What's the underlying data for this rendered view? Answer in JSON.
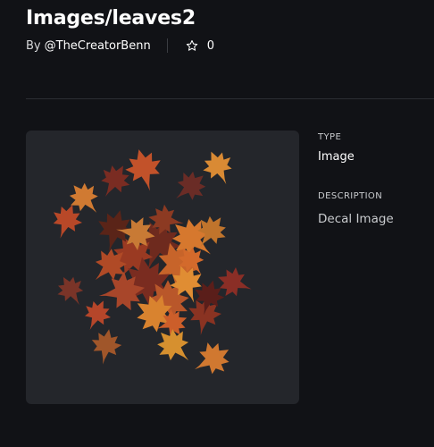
{
  "asset": {
    "title": "Images/leaves2",
    "by_prefix": "By",
    "creator": "@TheCreatorBenn",
    "favorite_count": "0"
  },
  "icons": {
    "favorite": "star-outline-icon"
  },
  "details": {
    "type_label": "TYPE",
    "type_value": "Image",
    "description_label": "DESCRIPTION",
    "description_value": "Decal Image"
  },
  "colors": {
    "background": "#111216",
    "thumbnail_background": "#24262b",
    "leaf_orange": "#d8782a",
    "leaf_red": "#8a2f1f",
    "leaf_brown": "#5a2a1c"
  }
}
